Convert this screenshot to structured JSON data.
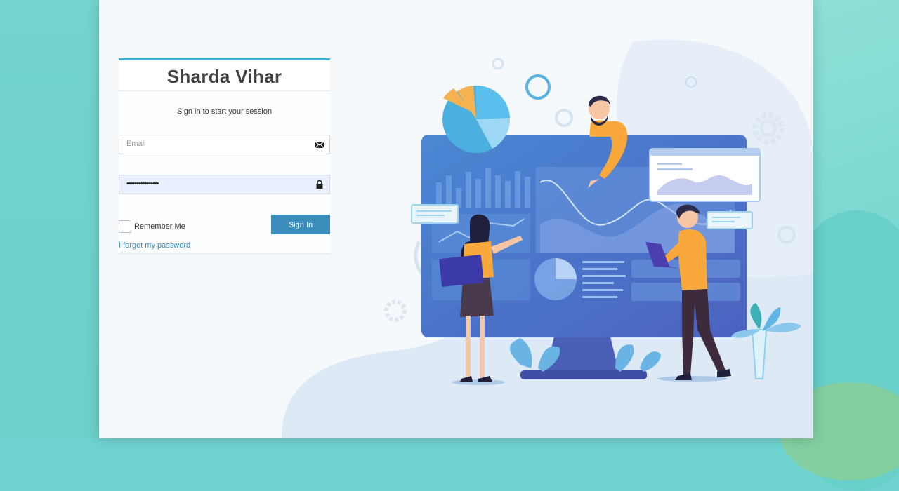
{
  "brand": {
    "title": "Sharda Vihar"
  },
  "login": {
    "message": "Sign in to start your session",
    "email_placeholder": "Email",
    "password_value": "••••••••••••••••",
    "remember_label": "Remember Me",
    "signin_label": "Sign In",
    "forgot_label": "I forgot my password"
  },
  "icons": {
    "email": "envelope-icon",
    "password": "lock-icon"
  },
  "colors": {
    "accent": "#3c8dbc",
    "top_bar": "#3ab3dd",
    "page_background": "#6fd3cf",
    "monitor": "#4a7ed0"
  }
}
